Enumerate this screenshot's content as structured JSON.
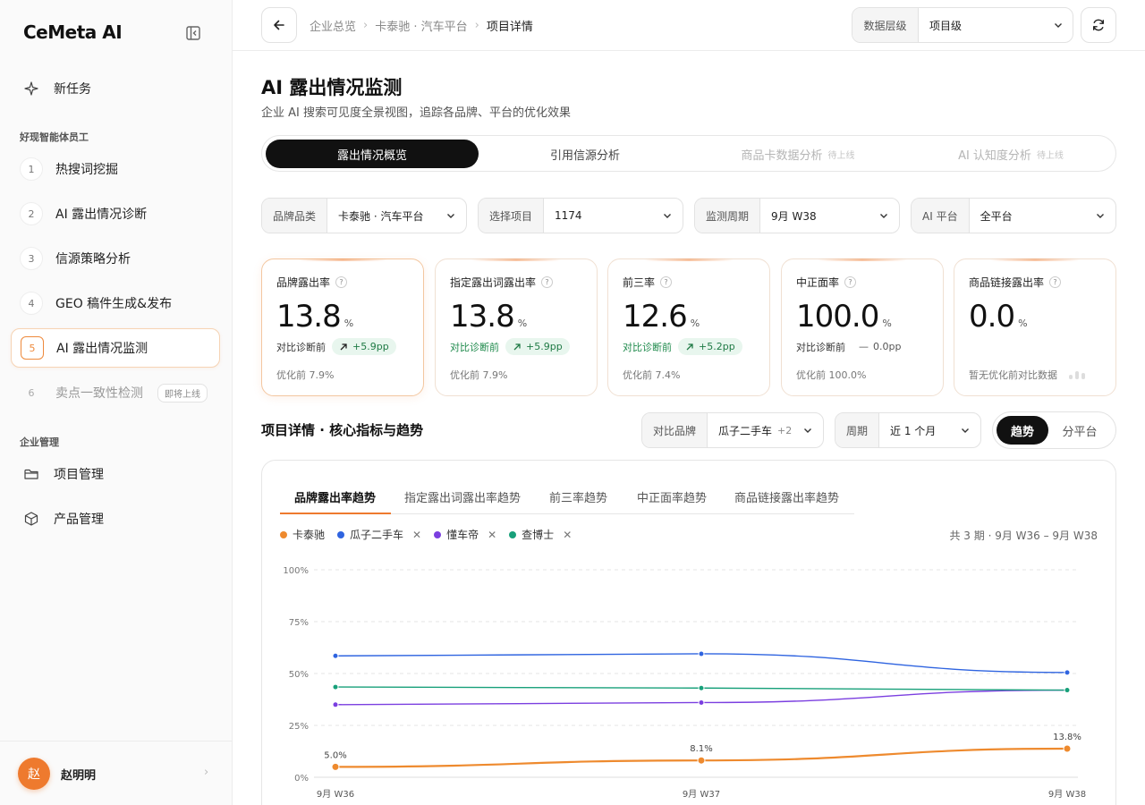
{
  "sidebar": {
    "logo": "CeMeta AI",
    "new_task": "新任务",
    "section_agents": "好现智能体员工",
    "items": [
      {
        "num": "1",
        "label": "热搜词挖掘"
      },
      {
        "num": "2",
        "label": "AI 露出情况诊断"
      },
      {
        "num": "3",
        "label": "信源策略分析"
      },
      {
        "num": "4",
        "label": "GEO 稿件生成&发布"
      },
      {
        "num": "5",
        "label": "AI 露出情况监测"
      },
      {
        "num": "6",
        "label": "卖点一致性检测",
        "tag": "即将上线"
      }
    ],
    "section_enterprise": "企业管理",
    "enterprise_items": [
      {
        "label": "项目管理",
        "icon": "folder-icon"
      },
      {
        "label": "产品管理",
        "icon": "box-icon"
      }
    ],
    "user": {
      "avatar": "赵",
      "name": "赵明明"
    }
  },
  "topbar": {
    "breadcrumbs": [
      "企业总览",
      "卡泰驰 · 汽车平台",
      "项目详情"
    ],
    "level_label": "数据层级",
    "level_value": "项目级"
  },
  "page": {
    "title": "AI 露出情况监测",
    "subtitle": "企业 AI 搜索可见度全景视图，追踪各品牌、平台的优化效果"
  },
  "tabs": [
    {
      "label": "露出情况概览",
      "active": true
    },
    {
      "label": "引用信源分析"
    },
    {
      "label": "商品卡数据分析",
      "soon": "待上线"
    },
    {
      "label": "AI 认知度分析",
      "soon": "待上线"
    }
  ],
  "filters": [
    {
      "key": "品牌品类",
      "value": "卡泰驰 · 汽车平台"
    },
    {
      "key": "选择项目",
      "value": "1174"
    },
    {
      "key": "监测周期",
      "value": "9月 W38"
    },
    {
      "key": "AI 平台",
      "value": "全平台"
    }
  ],
  "kpis": [
    {
      "name": "品牌露出率",
      "value": "13.8",
      "unit": "%",
      "cmp_label": "对比诊断前",
      "delta": "+5.9pp",
      "before": "优化前 7.9%"
    },
    {
      "name": "指定露出词露出率",
      "value": "13.8",
      "unit": "%",
      "cmp_label": "对比诊断前",
      "delta": "+5.9pp",
      "before": "优化前 7.9%"
    },
    {
      "name": "前三率",
      "value": "12.6",
      "unit": "%",
      "cmp_label": "对比诊断前",
      "delta": "+5.2pp",
      "before": "优化前 7.4%"
    },
    {
      "name": "中正面率",
      "value": "100.0",
      "unit": "%",
      "cmp_label": "对比诊断前",
      "delta": "0.0pp",
      "before": "优化前 100.0%"
    },
    {
      "name": "商品链接露出率",
      "value": "0.0",
      "unit": "%",
      "before": "暂无优化前对比数据"
    }
  ],
  "trend_section": {
    "title": "项目详情 · 核心指标与趋势",
    "compare_label": "对比品牌",
    "compare_value": "瓜子二手车",
    "compare_extra": "+2",
    "period_label": "周期",
    "period_value": "近 1 个月",
    "seg_trend": "趋势",
    "seg_platform": "分平台"
  },
  "chart_tabs": [
    "品牌露出率趋势",
    "指定露出词露出率趋势",
    "前三率趋势",
    "中正面率趋势",
    "商品链接露出率趋势"
  ],
  "range_info": "共 3 期 · 9月 W36 – 9月 W38",
  "colors": {
    "accent": "#ee7a2e",
    "卡泰驰": "#ee8a2e",
    "瓜子二手车": "#2f64e0",
    "懂车帝": "#7b3fe0",
    "查博士": "#18a07a"
  },
  "chart_data": {
    "type": "line",
    "categories": [
      "9月 W36",
      "9月 W37",
      "9月 W38"
    ],
    "ylim": [
      0,
      100
    ],
    "yticks": [
      "0%",
      "25%",
      "50%",
      "75%",
      "100%"
    ],
    "series": [
      {
        "name": "卡泰驰",
        "values": [
          5.0,
          8.1,
          13.8
        ],
        "labels": [
          "5.0%",
          "8.1%",
          "13.8%"
        ],
        "removable": false
      },
      {
        "name": "瓜子二手车",
        "values": [
          58.5,
          59.5,
          50.5
        ],
        "removable": true
      },
      {
        "name": "懂车帝",
        "values": [
          35.0,
          36.0,
          42.0
        ],
        "removable": true
      },
      {
        "name": "查博士",
        "values": [
          43.5,
          43.0,
          42.0
        ],
        "removable": true
      }
    ]
  }
}
